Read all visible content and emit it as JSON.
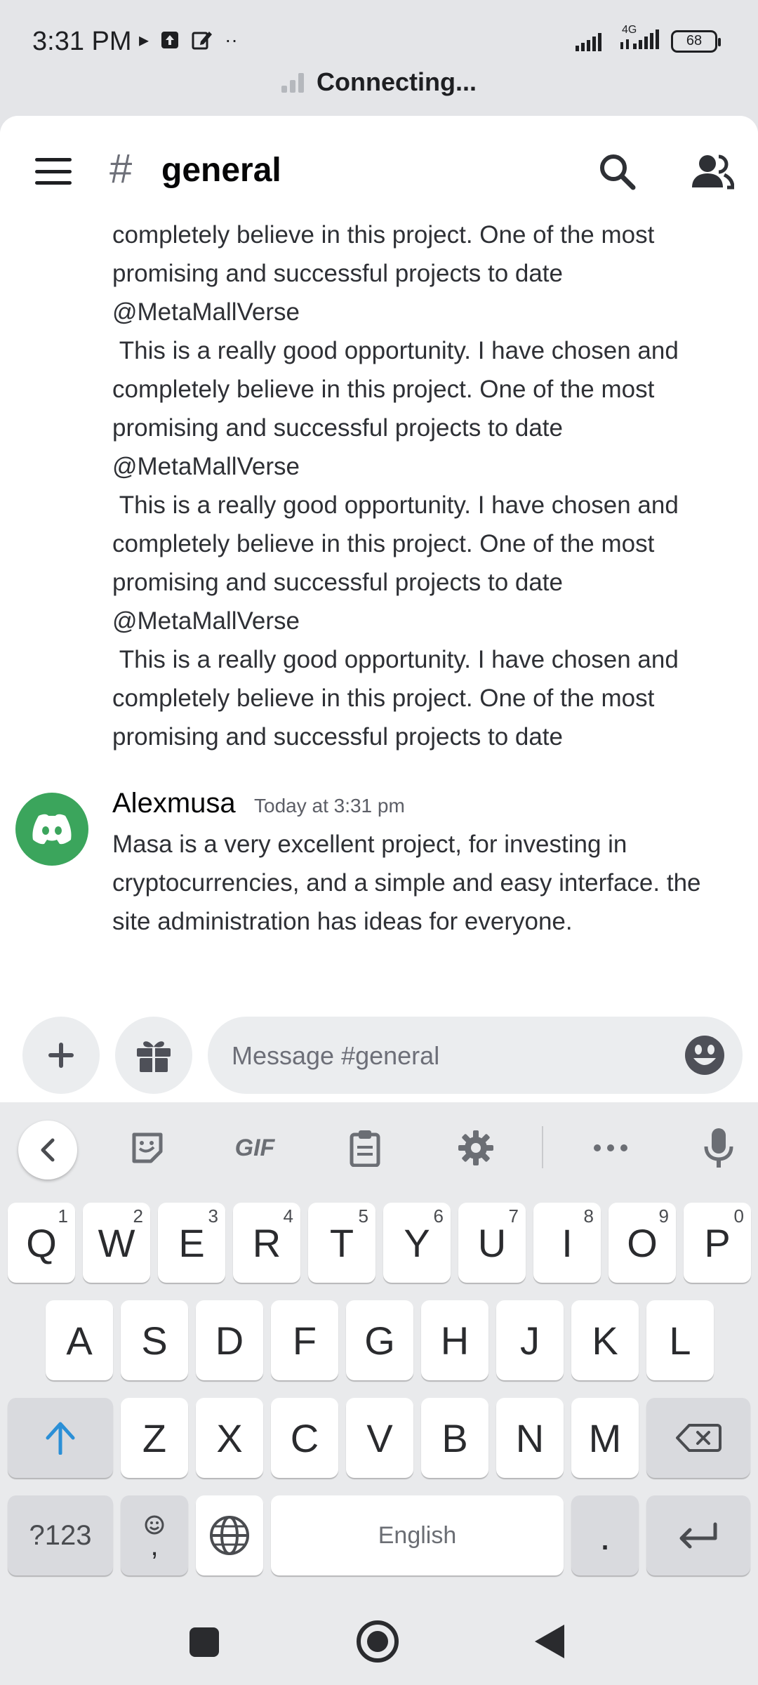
{
  "status_bar": {
    "time": "3:31 PM",
    "network": "4G",
    "battery": "68",
    "connection_status": "Connecting..."
  },
  "header": {
    "channel_hash": "#",
    "channel_name": "general"
  },
  "messages": {
    "previous_fragment": "completely believe in this project. One of the most\npromising and successful projects to date\n@MetaMallVerse\n This is a really good opportunity. I have chosen and\ncompletely believe in this project. One of the most\npromising and successful projects to date\n@MetaMallVerse\n This is a really good opportunity. I have chosen and\ncompletely believe in this project. One of the most\npromising and successful projects to date\n@MetaMallVerse\n This is a really good opportunity. I have chosen and\ncompletely believe in this project. One of the most\npromising and successful projects to date",
    "latest": {
      "author": "Alexmusa",
      "timestamp": "Today at 3:31 pm",
      "text": "Masa is a very excellent project, for investing in\ncryptocurrencies, and a simple and easy interface. the\nsite administration has ideas for everyone."
    }
  },
  "composer": {
    "placeholder": "Message #general"
  },
  "keyboard": {
    "toolbar": {
      "gif_label": "GIF"
    },
    "row1": [
      {
        "label": "Q",
        "hint": "1"
      },
      {
        "label": "W",
        "hint": "2"
      },
      {
        "label": "E",
        "hint": "3"
      },
      {
        "label": "R",
        "hint": "4"
      },
      {
        "label": "T",
        "hint": "5"
      },
      {
        "label": "Y",
        "hint": "6"
      },
      {
        "label": "U",
        "hint": "7"
      },
      {
        "label": "I",
        "hint": "8"
      },
      {
        "label": "O",
        "hint": "9"
      },
      {
        "label": "P",
        "hint": "0"
      }
    ],
    "row2": [
      "A",
      "S",
      "D",
      "F",
      "G",
      "H",
      "J",
      "K",
      "L"
    ],
    "row3": [
      "Z",
      "X",
      "C",
      "V",
      "B",
      "N",
      "M"
    ],
    "bottom": {
      "symbols_label": "?123",
      "comma_label": ",",
      "space_label": "English",
      "period_label": "."
    }
  }
}
